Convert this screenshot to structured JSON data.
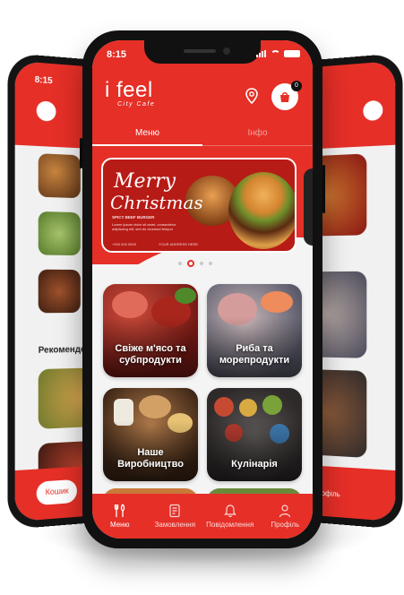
{
  "status_bar": {
    "time": "8:15"
  },
  "header": {
    "logo_text": "i feel",
    "logo_subtitle": "City Cafe",
    "cart_count": "0",
    "location_icon": "location-pin-icon",
    "cart_icon": "shopping-bag-icon"
  },
  "tabs": [
    {
      "label": "Меню",
      "active": true
    },
    {
      "label": "Інфо",
      "active": false
    }
  ],
  "banner": {
    "title_line1": "Merry",
    "title_line2": "Christmas",
    "tagline": "SPICY BEEF BURGER",
    "body": "Lorem ipsum dolor sit amet, consectetur adipiscing elit, sed do eiusmod tempor",
    "phone": "+000 000 0000",
    "address": "YOUR ADDRESS HERE"
  },
  "carousel": {
    "total": 4,
    "active_index": 1
  },
  "categories": [
    {
      "label": "Свіже м'ясо та\nсубпродукти"
    },
    {
      "label": "Риба та\nморепродукти"
    },
    {
      "label": "Наше\nВиробництво"
    },
    {
      "label": "Кулінарія"
    }
  ],
  "bottom_nav": [
    {
      "label": "Меню",
      "icon": "fork-knife-icon",
      "active": true
    },
    {
      "label": "Замовлення",
      "icon": "order-list-icon",
      "active": false
    },
    {
      "label": "Повідомлення",
      "icon": "bell-icon",
      "active": false
    },
    {
      "label": "Профіль",
      "icon": "user-icon",
      "active": false
    }
  ],
  "back_left": {
    "time": "8:15",
    "section_label": "Рекомендо",
    "cart_pill": "Кошик"
  },
  "back_right": {
    "nav_label": "Профіль"
  },
  "colors": {
    "accent": "#e52f27",
    "background": "#f4f4f4",
    "frame": "#111111"
  }
}
